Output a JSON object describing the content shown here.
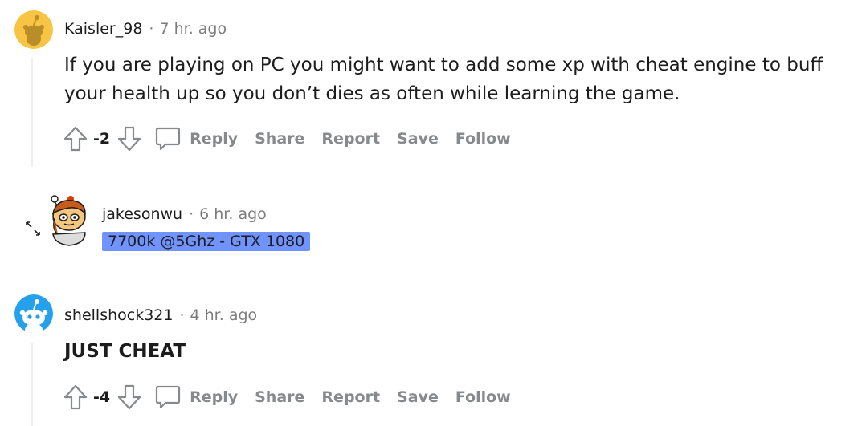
{
  "comments": [
    {
      "author": "Kaisler_98",
      "separator": "·",
      "time": "7 hr. ago",
      "body": "If you are playing on PC you might want to add some xp with cheat engine to buff your health up so you don’t dies as often while learning the game.",
      "score": "-2",
      "actions": [
        "Reply",
        "Share",
        "Report",
        "Save",
        "Follow"
      ]
    },
    {
      "author": "jakesonwu",
      "separator": "·",
      "time": "6 hr. ago",
      "flair": "7700k @5Ghz - GTX 1080",
      "collapsed": true
    },
    {
      "author": "shellshock321",
      "separator": "·",
      "time": "4 hr. ago",
      "body": "JUST CHEAT",
      "score": "-4",
      "actions": [
        "Reply",
        "Share",
        "Report",
        "Save",
        "Follow"
      ]
    }
  ],
  "icons": {
    "upvote": "upvote-arrow-icon",
    "downvote": "downvote-arrow-icon",
    "reply": "comment-bubble-icon",
    "expand": "expand-arrows-icon"
  },
  "colors": {
    "flair_bg": "#7193ff",
    "meta_gray": "#7c7c7c",
    "action_gray": "#878a8c",
    "thread_line": "#edeff1",
    "avatar_yellow": "#f7c444",
    "avatar_blue": "#24a0ed"
  }
}
